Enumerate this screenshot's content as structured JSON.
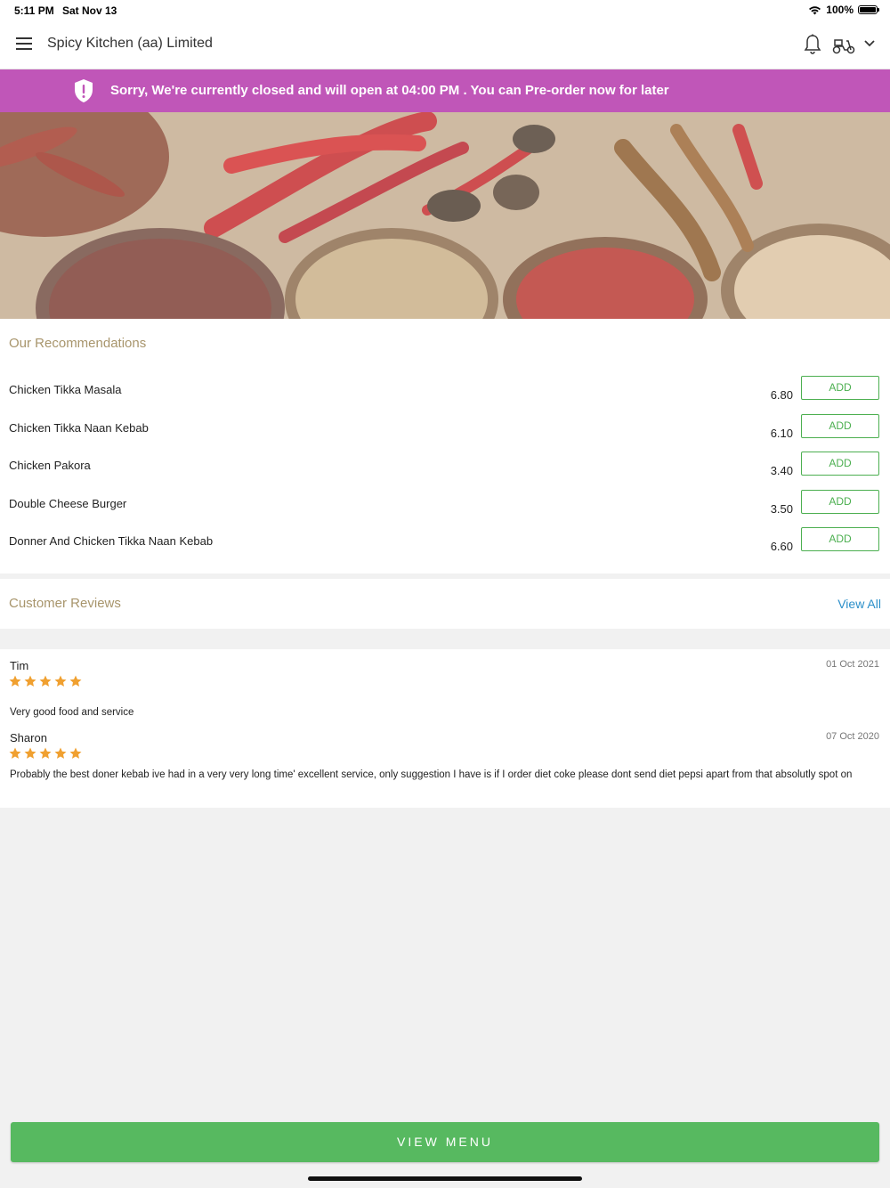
{
  "status_bar": {
    "time": "5:11 PM",
    "date": "Sat Nov 13",
    "battery": "100%"
  },
  "app_bar": {
    "menu_icon": "hamburger-icon",
    "title": "Spicy Kitchen (aa) Limited",
    "notification_icon": "bell-icon",
    "delivery_icon": "scooter-icon",
    "dropdown_icon": "chevron-down-icon"
  },
  "banner": {
    "icon": "shield-alert-icon",
    "message": "Sorry, We're currently closed and will open at 04:00 PM . You can Pre-order now for later",
    "color": "#c056b8"
  },
  "recommendations": {
    "title": "Our Recommendations",
    "add_label": "ADD",
    "items": [
      {
        "name": "Chicken Tikka Masala",
        "price": "6.80"
      },
      {
        "name": "Chicken Tikka Naan Kebab",
        "price": "6.10"
      },
      {
        "name": "Chicken Pakora",
        "price": "3.40"
      },
      {
        "name": "Double Cheese Burger",
        "price": "3.50"
      },
      {
        "name": "Donner And Chicken Tikka Naan Kebab",
        "price": "6.60"
      }
    ]
  },
  "reviews": {
    "title": "Customer Reviews",
    "view_all": "View All",
    "items": [
      {
        "author": "Tim",
        "date": "01 Oct 2021",
        "rating": 5,
        "text": "Very good food and service"
      },
      {
        "author": "Sharon",
        "date": "07 Oct 2020",
        "rating": 5,
        "text": "Probably the best doner  kebab ive had in a very very long time' excellent service, only suggestion I have is if I order diet coke please dont send diet pepsi apart from that absolutly spot on"
      }
    ]
  },
  "footer": {
    "view_menu": "VIEW MENU",
    "accent": "#57b960"
  },
  "colors": {
    "section_title": "#a8956c",
    "link": "#2b8fc9",
    "add_button": "#4caf50",
    "star": "#f0a030"
  }
}
